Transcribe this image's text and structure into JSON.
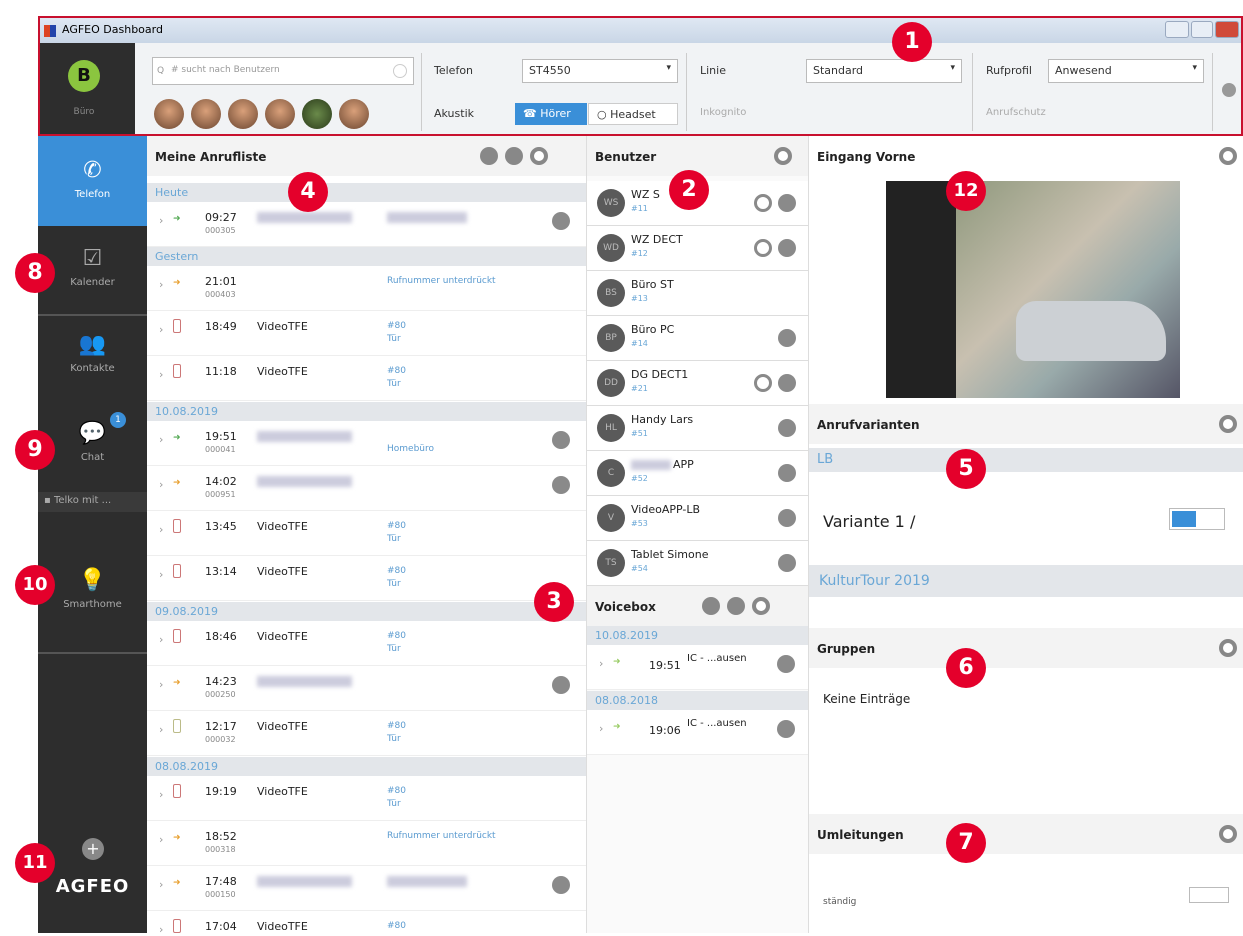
{
  "window": {
    "title": "AGFEO Dashboard"
  },
  "toolbar": {
    "user_initial": "B",
    "user_name": "Büro",
    "search_placeholder": "# sucht nach Benutzern",
    "telefon_label": "Telefon",
    "telefon_value": "ST4550",
    "akustik_label": "Akustik",
    "hoerer": "Hörer",
    "headset": "Headset",
    "linie_label": "Linie",
    "linie_value": "Standard",
    "inkognito": "Inkognito",
    "rufprofil_label": "Rufprofil",
    "rufprofil_value": "Anwesend",
    "anrufschutz": "Anrufschutz"
  },
  "sidebar": {
    "telefon": "Telefon",
    "kalender": "Kalender",
    "kontakte": "Kontakte",
    "chat": "Chat",
    "chat_badge": "1",
    "telko": "Telko mit ...",
    "smarthome": "Smarthome",
    "brand": "AGFEO"
  },
  "calls": {
    "title": "Meine Anrufliste",
    "sections": {
      "heute": "Heute",
      "gestern": "Gestern",
      "d1": "10.08.2019",
      "d2": "09.08.2019",
      "d3": "08.08.2019"
    },
    "rows": [
      {
        "time": "09:27",
        "dur": "000305"
      },
      {
        "time": "21:01",
        "dur": "000403",
        "info": "Rufnummer unterdrückt"
      },
      {
        "time": "18:49",
        "name": "VideoTFE",
        "info": "#80",
        "info2": "Tür"
      },
      {
        "time": "11:18",
        "name": "VideoTFE",
        "info": "#80",
        "info2": "Tür"
      },
      {
        "time": "19:51",
        "dur": "000041",
        "info2": "Homebüro"
      },
      {
        "time": "14:02",
        "dur": "000951"
      },
      {
        "time": "13:45",
        "name": "VideoTFE",
        "info": "#80",
        "info2": "Tür"
      },
      {
        "time": "13:14",
        "name": "VideoTFE",
        "info": "#80",
        "info2": "Tür"
      },
      {
        "time": "18:46",
        "name": "VideoTFE",
        "info": "#80",
        "info2": "Tür"
      },
      {
        "time": "14:23",
        "dur": "000250"
      },
      {
        "time": "12:17",
        "name": "VideoTFE",
        "dur": "000032",
        "info": "#80",
        "info2": "Tür"
      },
      {
        "time": "19:19",
        "name": "VideoTFE",
        "info": "#80",
        "info2": "Tür"
      },
      {
        "time": "18:52",
        "dur": "000318",
        "info": "Rufnummer unterdrückt"
      },
      {
        "time": "17:48",
        "dur": "000150"
      },
      {
        "time": "17:04",
        "name": "VideoTFE",
        "info": "#80"
      }
    ]
  },
  "users": {
    "title": "Benutzer",
    "list": [
      {
        "initials": "WS",
        "name": "WZ S",
        "ext": "#11"
      },
      {
        "initials": "WD",
        "name": "WZ DECT",
        "ext": "#12"
      },
      {
        "initials": "BS",
        "name": "Büro ST",
        "ext": "#13"
      },
      {
        "initials": "BP",
        "name": "Büro PC",
        "ext": "#14"
      },
      {
        "initials": "DD",
        "name": "DG DECT1",
        "ext": "#21"
      },
      {
        "initials": "HL",
        "name": "Handy Lars",
        "ext": "#51"
      },
      {
        "initials": "C",
        "name": "APP",
        "ext": "#52"
      },
      {
        "initials": "V",
        "name": "VideoAPP-LB",
        "ext": "#53"
      },
      {
        "initials": "TS",
        "name": "Tablet Simone",
        "ext": "#54"
      }
    ]
  },
  "voicebox": {
    "title": "Voicebox",
    "d1": "10.08.2019",
    "d2": "08.08.2018",
    "r1_time": "19:51",
    "r1_name": "IC - ...ausen",
    "r2_time": "19:06",
    "r2_name": "IC - ...ausen"
  },
  "right": {
    "eingang": "Eingang Vorne",
    "anrufvarianten": "Anrufvarianten",
    "lb": "LB",
    "variante": "Variante 1 /",
    "kultur": "KulturTour 2019",
    "gruppen": "Gruppen",
    "keine": "Keine Einträge",
    "umleitungen": "Umleitungen",
    "staendig": "ständig"
  },
  "badges": [
    "1",
    "2",
    "3",
    "4",
    "5",
    "6",
    "7",
    "8",
    "9",
    "10",
    "11",
    "12"
  ],
  "colors": {
    "accent": "#3a8fd8",
    "badge": "#e4002b",
    "sidebar": "#2d2d2d",
    "frame": "#c8102e"
  }
}
